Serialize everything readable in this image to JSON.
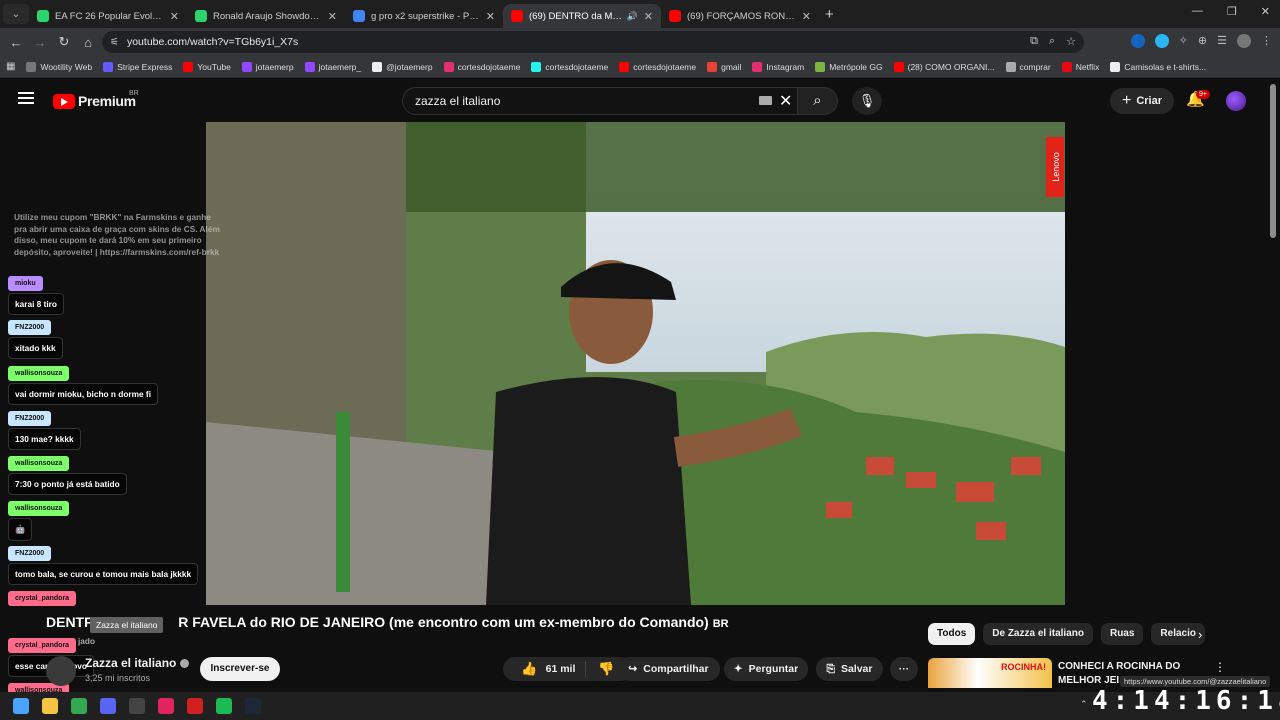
{
  "browser": {
    "tabs": [
      {
        "title": "EA FC 26 Popular Evolution Play",
        "icon_color": "#2bd46a",
        "active": false,
        "audio": false
      },
      {
        "title": "Ronald Araujo Showdown EA FC",
        "icon_color": "#2bd46a",
        "active": false,
        "audio": false
      },
      {
        "title": "g pro x2 superstrike - Pesquisa",
        "icon_color": "#4285f4",
        "active": false,
        "audio": false
      },
      {
        "title": "(69) DENTRO da MAIOR FA",
        "icon_color": "#ff0000",
        "active": true,
        "audio": true
      },
      {
        "title": "(69) FORÇAMOS RONALDINHO",
        "icon_color": "#ff0000",
        "active": false,
        "audio": false
      }
    ],
    "url": "youtube.com/watch?v=TGb6y1i_X7s",
    "bookmarks": [
      {
        "label": "Wootility Web",
        "color": "#777"
      },
      {
        "label": "Stripe Express",
        "color": "#635bff"
      },
      {
        "label": "YouTube",
        "color": "#ff0000"
      },
      {
        "label": "jotaemerp",
        "color": "#9146ff"
      },
      {
        "label": "jotaemerp_",
        "color": "#9146ff"
      },
      {
        "label": "@jotaemerp",
        "color": "#eeeeee"
      },
      {
        "label": "cortesdojotaeme",
        "color": "#e1306c"
      },
      {
        "label": "cortesdojotaeme",
        "color": "#25f4ee"
      },
      {
        "label": "cortesdojotaeme",
        "color": "#ff0000"
      },
      {
        "label": "gmail",
        "color": "#ea4335"
      },
      {
        "label": "Instagram",
        "color": "#e1306c"
      },
      {
        "label": "Metrópole GG",
        "color": "#7cb342"
      },
      {
        "label": "(28) COMO ORGANI...",
        "color": "#ff0000"
      },
      {
        "label": "comprar",
        "color": "#aaaaaa"
      },
      {
        "label": "Netflix",
        "color": "#e50914"
      },
      {
        "label": "Camisolas e t-shirts...",
        "color": "#eeeeee"
      }
    ]
  },
  "youtube": {
    "logo": "Premium",
    "region": "BR",
    "search_query": "zazza el italiano",
    "create_label": "Criar",
    "notif_count": "9+",
    "video_title": "DENTR",
    "video_title_rest": "R FAVELA do RIO DE JANEIRO (me encontro com um ex-membro do Comando)",
    "title_suffix": "BR",
    "tooltip": "Zazza el italiano",
    "channel_name": "Zazza el italiano",
    "subscribers": "3,25 mi inscritos",
    "subscribe_label": "Inscrever-se",
    "likes": "61 mil",
    "share_label": "Compartilhar",
    "ask_label": "Perguntar",
    "save_label": "Salvar",
    "chips": [
      "Todos",
      "De Zazza el italiano",
      "Ruas",
      "Relacio"
    ],
    "rec_title": "CONHECI A ROCINHA DO MELHOR JEI",
    "rec_thumb_text": "ROCINHA!",
    "status_url": "https://www.youtube.com/@zazzaelitaliano",
    "video_logo": "Lenovo"
  },
  "chat": {
    "promo": "Utilize meu cupom \"BRKK\" na Farmskins e ganhe pra abrir uma caixa de graça com skins de CS. Além disso, meu cupom te dará 10% em seu primeiro depósito, aproveite! | https://farmskins.com/ref-brkk",
    "messages": [
      {
        "name": "mioku",
        "text": "karai 8 tiro",
        "color": "#b98cff"
      },
      {
        "name": "FNZ2000",
        "text": "xitado kkk",
        "color": "#c8e6ff"
      },
      {
        "name": "wallisonsouza",
        "text": "vai dormir mioku, bicho n dorme fi",
        "color": "#7dff6a"
      },
      {
        "name": "FNZ2000",
        "text": "130 mae? kkkk",
        "color": "#c8e6ff"
      },
      {
        "name": "wallisonsouza",
        "text": "7:30 o ponto já está batido",
        "color": "#7dff6a"
      },
      {
        "name": "wallisonsouza",
        "text": "🤖",
        "color": "#7dff6a"
      },
      {
        "name": "FNZ2000",
        "text": "tomo bala, se curou e tomou mais bala jkkkk",
        "color": "#c8e6ff"
      },
      {
        "name": "crystal_pandora",
        "text": "",
        "color": "#ff6b8a"
      },
      {
        "name": "crystal_pandora",
        "text": "esse cara de novo",
        "color": "#ff6b8a"
      },
      {
        "name": "wallisonsouza",
        "text": "",
        "color": "#ff6b8a"
      }
    ],
    "partial_line": "jado"
  },
  "taskbar": {
    "clock": "4:14:16:18",
    "icons": [
      {
        "name": "start-icon",
        "color": "#4aa3ff"
      },
      {
        "name": "file-explorer-icon",
        "color": "#f4c542"
      },
      {
        "name": "chrome-icon",
        "color": "#34a853"
      },
      {
        "name": "discord-icon",
        "color": "#5865f2"
      },
      {
        "name": "obs-icon",
        "color": "#444"
      },
      {
        "name": "app-red-icon",
        "color": "#e0245e"
      },
      {
        "name": "app-red2-icon",
        "color": "#d21f1f"
      },
      {
        "name": "spotify-icon",
        "color": "#1db954"
      },
      {
        "name": "steam-icon",
        "color": "#1b2838"
      }
    ]
  }
}
